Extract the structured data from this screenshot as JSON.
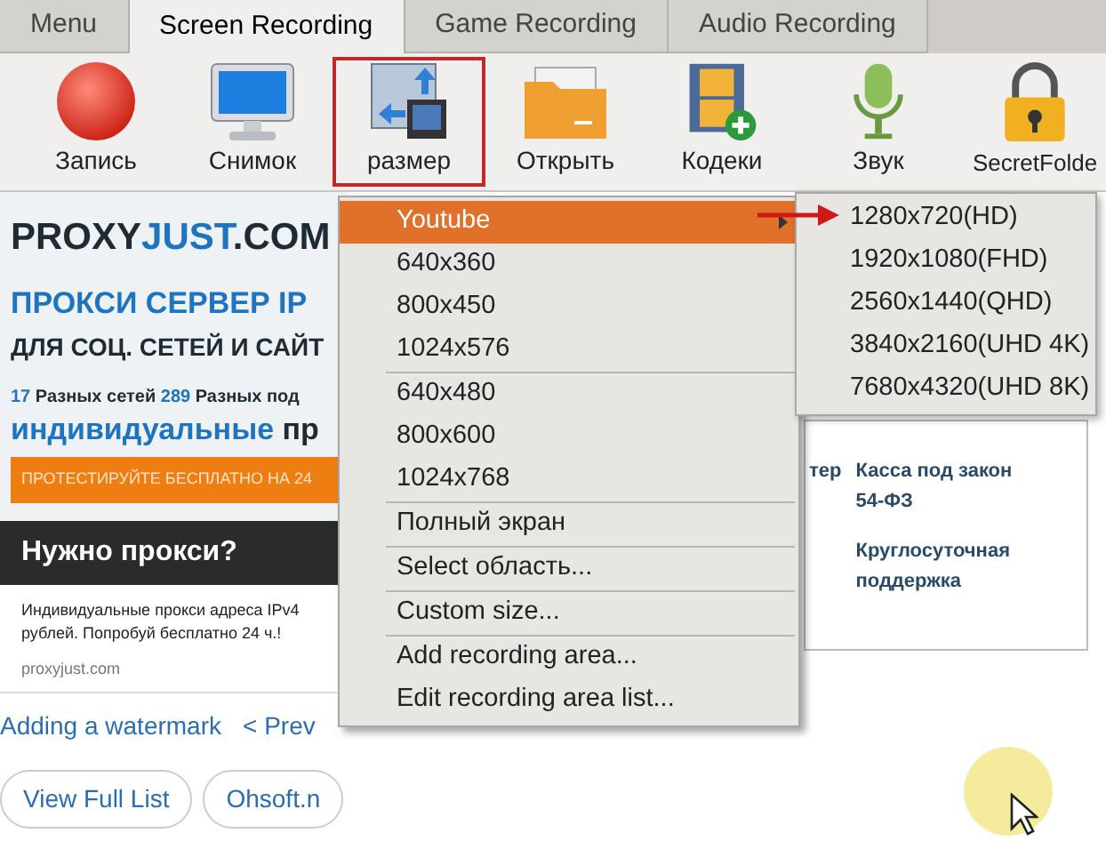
{
  "tabs": [
    {
      "label": "Menu",
      "selected": false
    },
    {
      "label": "Screen Recording",
      "selected": true
    },
    {
      "label": "Game Recording",
      "selected": false
    },
    {
      "label": "Audio Recording",
      "selected": false
    }
  ],
  "toolbar": [
    {
      "label": "Запись",
      "kind": "record",
      "selected": false
    },
    {
      "label": "Снимок",
      "kind": "monitor",
      "selected": false
    },
    {
      "label": "размер",
      "kind": "resize",
      "selected": true
    },
    {
      "label": "Открыть",
      "kind": "folder",
      "selected": false
    },
    {
      "label": "Кодеки",
      "kind": "film",
      "selected": false
    },
    {
      "label": "Звук",
      "kind": "mic",
      "selected": false
    },
    {
      "label": "SecretFolde",
      "kind": "lock",
      "selected": false
    }
  ],
  "webpage": {
    "ad": {
      "logo": [
        {
          "text": "PROXY",
          "kind": "dark"
        },
        {
          "text": "JUST",
          "kind": "accent"
        },
        {
          "text": ".COM",
          "kind": "dark"
        }
      ],
      "headline": "ПРОКСИ СЕРВЕР IP",
      "subheadline": "ДЛЯ СОЦ. СЕТЕЙ И САЙТ",
      "stats": [
        {
          "text": "17",
          "kind": "accent"
        },
        {
          "text": " Разных сетей ",
          "kind": "dark"
        },
        {
          "text": "289",
          "kind": "accent"
        },
        {
          "text": " Разных под",
          "kind": "dark"
        }
      ],
      "tagline": [
        {
          "text": "индивидуальные ",
          "kind": "accent"
        },
        {
          "text": "пр",
          "kind": "dark"
        }
      ],
      "cta": "ПРОТЕСТИРУЙТЕ БЕСПЛАТНО НА 24",
      "banner": "Нужно прокси?",
      "description": [
        "Индивидуальные прокси адреса IPv4",
        "рублей. Попробуй бесплатно 24 ч.!"
      ],
      "url": "proxyjust.com"
    },
    "nav_links": [
      "Adding a watermark",
      "< Prev"
    ],
    "buttons": [
      "View Full List",
      "Ohsoft.n"
    ],
    "card": {
      "fragment": "тер",
      "features": [
        "Касса под закон 54-ФЗ",
        "Круглосуточная поддержка"
      ]
    }
  },
  "menu": {
    "sections": [
      [
        {
          "label": "Youtube",
          "selected": true,
          "submenu": true
        },
        {
          "label": "640x360",
          "selected": false,
          "submenu": false
        },
        {
          "label": "800x450",
          "selected": false,
          "submenu": false
        },
        {
          "label": "1024x576",
          "selected": false,
          "submenu": false
        }
      ],
      [
        {
          "label": "640x480",
          "selected": false,
          "submenu": false
        },
        {
          "label": "800x600",
          "selected": false,
          "submenu": false
        },
        {
          "label": "1024x768",
          "selected": false,
          "submenu": false
        }
      ],
      [
        {
          "label": "Полный экран",
          "selected": false,
          "submenu": false
        }
      ],
      [
        {
          "label": "Select область...",
          "selected": false,
          "submenu": false
        }
      ],
      [
        {
          "label": "Custom size...",
          "selected": false,
          "submenu": false
        }
      ],
      [
        {
          "label": "Add recording area...",
          "selected": false,
          "submenu": false
        },
        {
          "label": "Edit recording area list...",
          "selected": false,
          "submenu": false
        }
      ]
    ],
    "submenu": [
      "1280x720(HD)",
      "1920x1080(FHD)",
      "2560x1440(QHD)",
      "3840x2160(UHD 4K)",
      "7680x4320(UHD 8K)"
    ]
  }
}
